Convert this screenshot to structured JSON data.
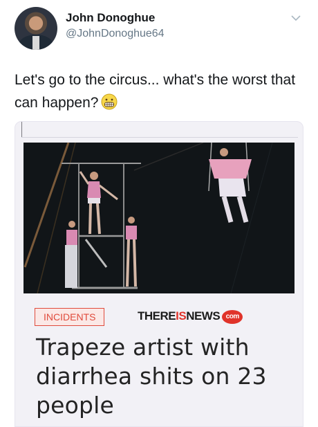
{
  "author": {
    "name": "John Donoghue",
    "handle": "@JohnDonoghue64"
  },
  "tweet": {
    "text": "Let's go to the circus... what's the worst that can happen?",
    "emoji": "grimacing-face-icon"
  },
  "card": {
    "tag": "INCIDENTS",
    "brand_prefix": "THERE",
    "brand_red": "IS",
    "brand_suffix": "NEWS",
    "brand_badge": "com",
    "headline": "Trapeze artist with diarrhea shits on 23 people"
  },
  "colors": {
    "accent_red": "#e0332a",
    "card_bg": "#f2f1f6",
    "handle_gray": "#657786"
  }
}
